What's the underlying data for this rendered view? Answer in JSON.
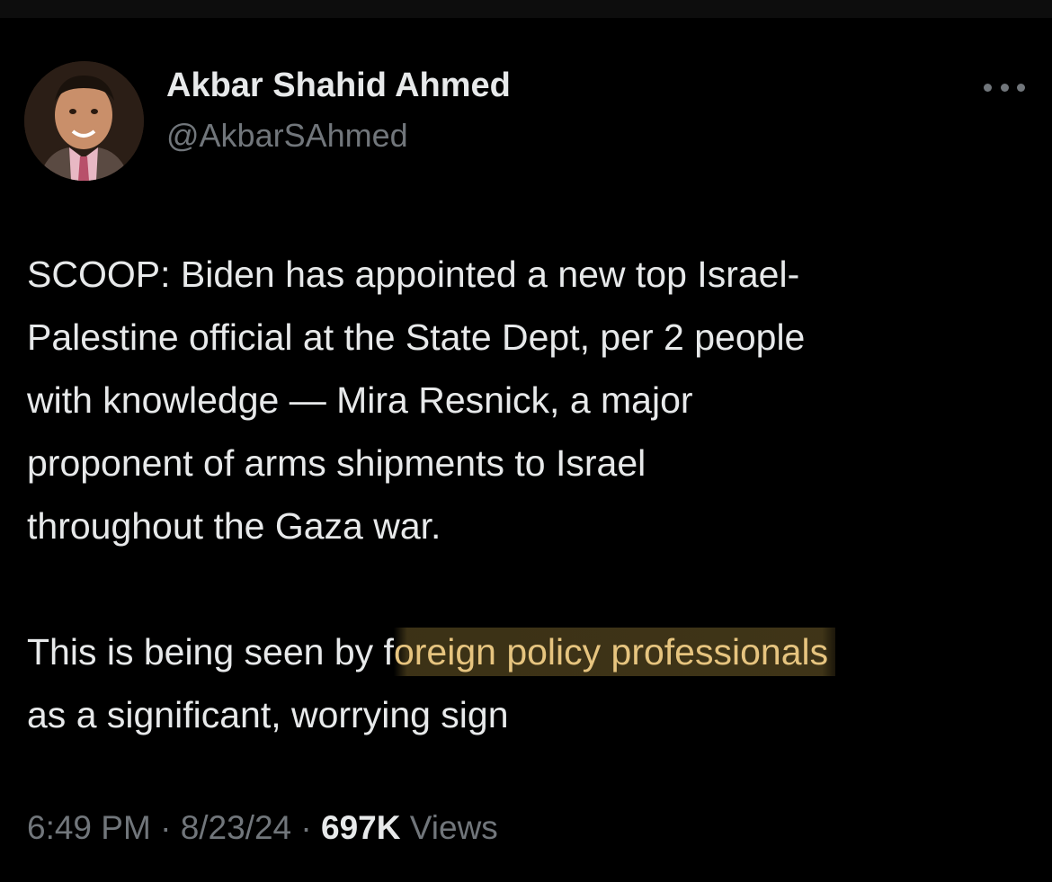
{
  "author": {
    "display_name": "Akbar Shahid Ahmed",
    "handle": "@AkbarSAhmed"
  },
  "tweet": {
    "lines": [
      "SCOOP: Biden has appointed a new top Israel-",
      "Palestine official at the State Dept, per 2 people",
      "with knowledge — Mira Resnick, a major",
      "proponent of arms shipments to Israel",
      "throughout the Gaza war."
    ],
    "para2_line1_plain": "This is being seen by f",
    "para2_line1_highlight": "oreign policy professionals",
    "para2_line2": "as a significant, worrying sign"
  },
  "meta": {
    "time": "6:49 PM",
    "sep1": " · ",
    "date": "8/23/24",
    "sep2": " · ",
    "views_count": "697K",
    "views_label": " Views"
  },
  "icons": {
    "more": "more-horizontal-icon"
  },
  "colors": {
    "background": "#000000",
    "primary_text": "#e7e9ea",
    "secondary_text": "#71767b",
    "highlight_text": "#e6c47f"
  }
}
